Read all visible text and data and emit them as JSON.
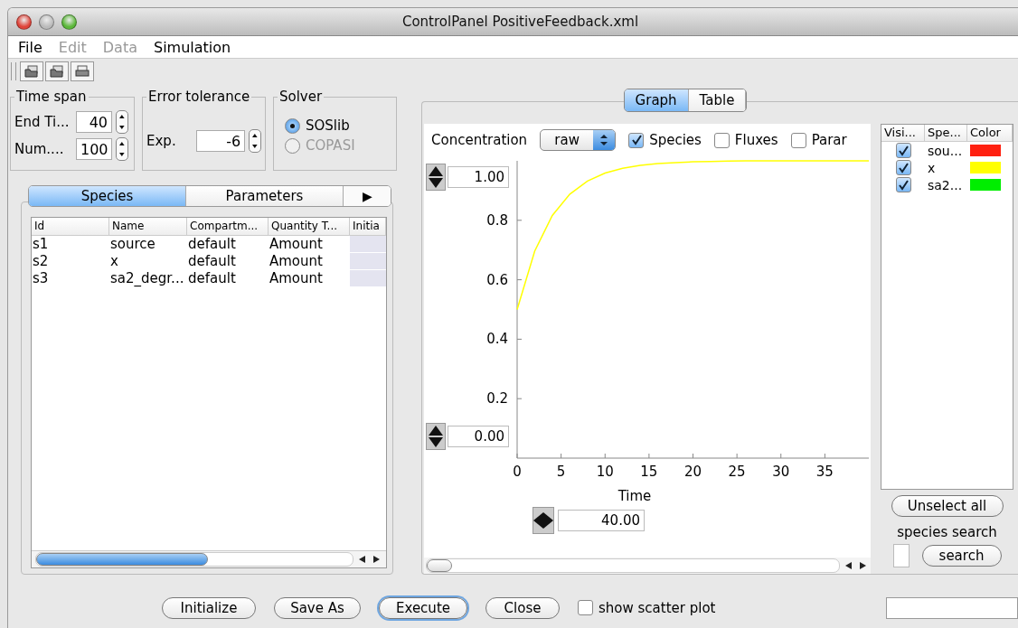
{
  "window": {
    "title": "ControlPanel PositiveFeedback.xml"
  },
  "menu": [
    {
      "label": "File",
      "disabled": false
    },
    {
      "label": "Edit",
      "disabled": true
    },
    {
      "label": "Data",
      "disabled": true
    },
    {
      "label": "Simulation",
      "disabled": false
    }
  ],
  "time_span": {
    "title": "Time span",
    "fields": [
      {
        "label": "End Ti...",
        "value": "40"
      },
      {
        "label": "Num....",
        "value": "100"
      }
    ]
  },
  "error_tolerance": {
    "title": "Error tolerance",
    "label": "Exp.",
    "value": "-6"
  },
  "solver": {
    "title": "Solver",
    "options": [
      {
        "label": "SOSlib",
        "selected": true,
        "disabled": false
      },
      {
        "label": "COPASI",
        "selected": false,
        "disabled": true
      }
    ]
  },
  "left_tabs": [
    {
      "label": "Species",
      "selected": true
    },
    {
      "label": "Parameters",
      "selected": false
    }
  ],
  "left_tabs_more": "▶",
  "species_table": {
    "columns": [
      "Id",
      "Name",
      "Compartm...",
      "Quantity T...",
      "Initia"
    ],
    "rows": [
      [
        "s1",
        "source",
        "default",
        "Amount",
        ""
      ],
      [
        "s2",
        "x",
        "default",
        "Amount",
        ""
      ],
      [
        "s3",
        "sa2_degr...",
        "default",
        "Amount",
        ""
      ]
    ]
  },
  "right_tabs": [
    {
      "label": "Graph",
      "selected": true
    },
    {
      "label": "Table",
      "selected": false
    }
  ],
  "graph": {
    "concentration_label": "Concentration",
    "scale": "raw",
    "checkboxes": [
      {
        "label": "Species",
        "checked": true
      },
      {
        "label": "Fluxes",
        "checked": false
      },
      {
        "label": "Parar",
        "checked": false
      }
    ],
    "y_max": "1.00",
    "y_min": "0.00",
    "x_max": "40.00",
    "chart_data": {
      "type": "line",
      "xlabel": "Time",
      "x": [
        0,
        2,
        4,
        6,
        8,
        10,
        12,
        14,
        16,
        18,
        20,
        22,
        24,
        26,
        28,
        30,
        32,
        34,
        36,
        38,
        40
      ],
      "series": [
        {
          "color": "#ffff00",
          "values": [
            0.5,
            0.697,
            0.816,
            0.888,
            0.932,
            0.959,
            0.975,
            0.985,
            0.991,
            0.994,
            0.997,
            0.998,
            0.999,
            1.0,
            1.0,
            1.0,
            1.0,
            1.0,
            1.0,
            1.0,
            1.0
          ]
        }
      ],
      "xlim": [
        0,
        40
      ],
      "ylim": [
        0,
        1
      ],
      "xticks": [
        0,
        5,
        10,
        15,
        20,
        25,
        30,
        35
      ],
      "yticks": [
        0.2,
        0.4,
        0.6,
        0.8
      ]
    }
  },
  "legend": {
    "columns": [
      "Visi...",
      "Spe...",
      "Color"
    ],
    "rows": [
      {
        "visible": true,
        "name": "sou...",
        "color": "#ff2010"
      },
      {
        "visible": true,
        "name": "x",
        "color": "#ffff00"
      },
      {
        "visible": true,
        "name": "sa2...",
        "color": "#00ee00"
      }
    ],
    "unselect_button": "Unselect all",
    "search_label": "species search",
    "search_button": "search"
  },
  "buttons": [
    {
      "label": "Initialize",
      "default": false
    },
    {
      "label": "Save As",
      "default": false
    },
    {
      "label": "Execute",
      "default": true
    },
    {
      "label": "Close",
      "default": false
    }
  ],
  "scatter": {
    "label": "show scatter plot",
    "checked": false
  }
}
